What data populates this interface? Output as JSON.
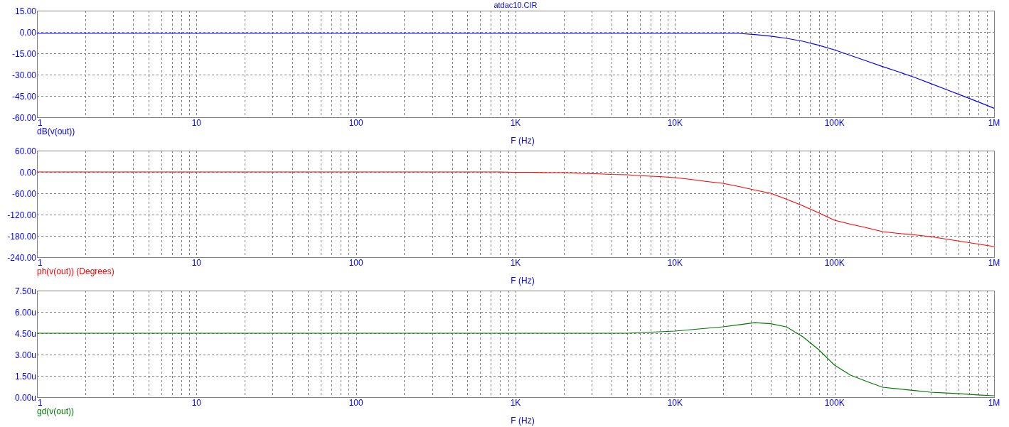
{
  "plots": [
    {
      "chart_data": {
        "type": "line",
        "title": "atdac10.CIR",
        "xlabel": "F (Hz)",
        "ylim": [
          -60,
          15
        ],
        "grid": true,
        "categories": [
          "1",
          null,
          null,
          null,
          null,
          null,
          null,
          null,
          null,
          null,
          "10",
          null,
          null,
          null,
          null,
          null,
          null,
          null,
          null,
          null,
          "100",
          null,
          null,
          null,
          null,
          null,
          null,
          null,
          null,
          null,
          "1K",
          null,
          null,
          null,
          null,
          null,
          null,
          null,
          null,
          null,
          "10K",
          null,
          null,
          null,
          null,
          null,
          null,
          null,
          null,
          null,
          "100K",
          null,
          null,
          null,
          null,
          null,
          null,
          null,
          null,
          null,
          "1M"
        ],
        "series": [
          {
            "name": "dB(v(out))",
            "color": "#0000ff",
            "values": [
              -1,
              -1,
              -1,
              -1,
              -1,
              -1,
              -1,
              -1,
              -1,
              -1,
              -1,
              -1,
              -1,
              -1,
              -1,
              -1,
              -1,
              -1,
              -1,
              -1,
              -1,
              -1,
              -1,
              -1,
              -1,
              -1,
              -1,
              -1,
              -1,
              -1,
              -1,
              -1,
              -1,
              -1,
              -1,
              -1,
              -1,
              -1,
              -1,
              -1,
              -1,
              -1,
              -1,
              -1,
              -1,
              -1.8,
              -2.9,
              -4.5,
              -6.5,
              -9.3,
              -12.6,
              -16.5,
              -20.4,
              -24.3,
              -28.0,
              -31.9,
              -36.2,
              -40.5,
              -44.8,
              -49.2,
              -53.7
            ]
          }
        ],
        "yticks": [
          {
            "value": 15,
            "label": "15.00"
          },
          {
            "value": 0,
            "label": "0.00"
          },
          {
            "value": -15,
            "label": "-15.00"
          },
          {
            "value": -30,
            "label": "-30.00"
          },
          {
            "value": -45,
            "label": "-45.00"
          },
          {
            "value": -60,
            "label": "-60.00"
          }
        ]
      }
    },
    {
      "chart_data": {
        "type": "line",
        "xlabel": "F (Hz)",
        "ylim": [
          -240,
          60
        ],
        "grid": true,
        "categories": [
          "1",
          null,
          null,
          null,
          null,
          null,
          null,
          null,
          null,
          null,
          "10",
          null,
          null,
          null,
          null,
          null,
          null,
          null,
          null,
          null,
          "100",
          null,
          null,
          null,
          null,
          null,
          null,
          null,
          null,
          null,
          "1K",
          null,
          null,
          null,
          null,
          null,
          null,
          null,
          null,
          null,
          "10K",
          null,
          null,
          null,
          null,
          null,
          null,
          null,
          null,
          null,
          "100K",
          null,
          null,
          null,
          null,
          null,
          null,
          null,
          null,
          null,
          "1M"
        ],
        "series": [
          {
            "name": "ph(v(out)) (Degrees)",
            "color": "#ff0000",
            "values": [
              0,
              0,
              0,
              0,
              0,
              0,
              0,
              0,
              0,
              0,
              0,
              0,
              0,
              0,
              0,
              0,
              0,
              0,
              0,
              0,
              0,
              0,
              0,
              0,
              0,
              0,
              0,
              0,
              0,
              0,
              -1,
              -1,
              -2,
              -2,
              -4,
              -5,
              -7,
              -8,
              -11,
              -13,
              -16,
              -21,
              -27,
              -32,
              -41,
              -51,
              -60,
              -77,
              -95,
              -115,
              -136,
              -147,
              -157,
              -168,
              -173,
              -177,
              -182,
              -189,
              -196,
              -203,
              -210
            ]
          }
        ],
        "yticks": [
          {
            "value": 60,
            "label": "60.00"
          },
          {
            "value": 0,
            "label": "0.00"
          },
          {
            "value": -60,
            "label": "-60.00"
          },
          {
            "value": -120,
            "label": "-120.00"
          },
          {
            "value": -180,
            "label": "-180.00"
          },
          {
            "value": -240,
            "label": "-240.00"
          }
        ]
      }
    },
    {
      "chart_data": {
        "type": "line",
        "xlabel": "F (Hz)",
        "ylim": [
          0,
          7.5
        ],
        "grid": true,
        "categories": [
          "1",
          null,
          null,
          null,
          null,
          null,
          null,
          null,
          null,
          null,
          "10",
          null,
          null,
          null,
          null,
          null,
          null,
          null,
          null,
          null,
          "100",
          null,
          null,
          null,
          null,
          null,
          null,
          null,
          null,
          null,
          "1K",
          null,
          null,
          null,
          null,
          null,
          null,
          null,
          null,
          null,
          "10K",
          null,
          null,
          null,
          null,
          null,
          null,
          null,
          null,
          null,
          "100K",
          null,
          null,
          null,
          null,
          null,
          null,
          null,
          null,
          null,
          "1M"
        ],
        "series": [
          {
            "name": "gd(v(out))",
            "color": "#007700",
            "values": [
              4.5,
              4.5,
              4.5,
              4.5,
              4.5,
              4.5,
              4.5,
              4.5,
              4.5,
              4.5,
              4.5,
              4.5,
              4.5,
              4.5,
              4.5,
              4.5,
              4.5,
              4.5,
              4.5,
              4.5,
              4.5,
              4.5,
              4.5,
              4.5,
              4.5,
              4.5,
              4.5,
              4.5,
              4.5,
              4.5,
              4.5,
              4.5,
              4.5,
              4.5,
              4.5,
              4.5,
              4.5,
              4.5,
              4.55,
              4.6,
              4.65,
              4.75,
              4.85,
              4.95,
              5.09,
              5.24,
              5.17,
              4.94,
              4.26,
              3.35,
              2.25,
              1.55,
              1.11,
              0.7,
              0.58,
              0.47,
              0.35,
              0.29,
              0.23,
              0.16,
              0.1
            ]
          }
        ],
        "yticks": [
          {
            "value": 7.5,
            "label": "7.50u"
          },
          {
            "value": 6,
            "label": "6.00u"
          },
          {
            "value": 4.5,
            "label": "4.50u"
          },
          {
            "value": 3,
            "label": "3.00u"
          },
          {
            "value": 1.5,
            "label": "1.50u"
          },
          {
            "value": 0,
            "label": "0.00u"
          }
        ]
      }
    }
  ]
}
